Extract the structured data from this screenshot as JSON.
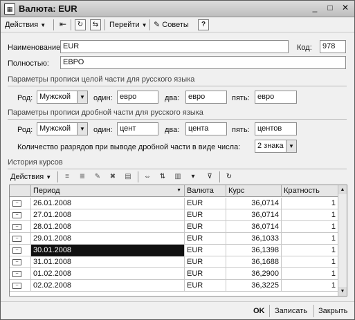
{
  "window": {
    "title": "Валюта: EUR",
    "icon": "table-icon"
  },
  "titlebar_buttons": {
    "minimize": "_",
    "maximize": "□",
    "close": "✕"
  },
  "toolbar": {
    "actions_label": "Действия",
    "goto_label": "Перейти",
    "tips_label": "Советы",
    "help_label": "?"
  },
  "form": {
    "name_label": "Наименование:",
    "name_value": "EUR",
    "code_label": "Код:",
    "code_value": "978",
    "full_label": "Полностью:",
    "full_value": "ЕВРО"
  },
  "whole_section": {
    "title": "Параметры прописи целой части для русского языка",
    "gender_label": "Род:",
    "gender_value": "Мужской",
    "one_label": "один:",
    "one_value": "евро",
    "two_label": "два:",
    "two_value": "евро",
    "five_label": "пять:",
    "five_value": "евро"
  },
  "fraction_section": {
    "title": "Параметры прописи дробной части для русского языка",
    "gender_label": "Род:",
    "gender_value": "Мужской",
    "one_label": "один:",
    "one_value": "цент",
    "two_label": "два:",
    "two_value": "цента",
    "five_label": "пять:",
    "five_value": "центов",
    "digits_label": "Количество разрядов при выводе дробной части в виде числа:",
    "digits_value": "2 знака"
  },
  "history": {
    "title": "История курсов",
    "actions_label": "Действия",
    "columns": [
      "Период",
      "Валюта",
      "Курс",
      "Кратность"
    ],
    "rows": [
      {
        "period": "26.01.2008",
        "currency": "EUR",
        "rate": "36,0714",
        "mult": "1"
      },
      {
        "period": "27.01.2008",
        "currency": "EUR",
        "rate": "36,0714",
        "mult": "1"
      },
      {
        "period": "28.01.2008",
        "currency": "EUR",
        "rate": "36,0714",
        "mult": "1"
      },
      {
        "period": "29.01.2008",
        "currency": "EUR",
        "rate": "36,1033",
        "mult": "1"
      },
      {
        "period": "30.01.2008",
        "currency": "EUR",
        "rate": "36,1398",
        "mult": "1"
      },
      {
        "period": "31.01.2008",
        "currency": "EUR",
        "rate": "36,1688",
        "mult": "1"
      },
      {
        "period": "01.02.2008",
        "currency": "EUR",
        "rate": "36,2900",
        "mult": "1"
      },
      {
        "period": "02.02.2008",
        "currency": "EUR",
        "rate": "36,3225",
        "mult": "1"
      }
    ],
    "selected_row": 4
  },
  "bottom": {
    "ok_label": "OK",
    "save_label": "Записать",
    "close_label": "Закрыть"
  }
}
